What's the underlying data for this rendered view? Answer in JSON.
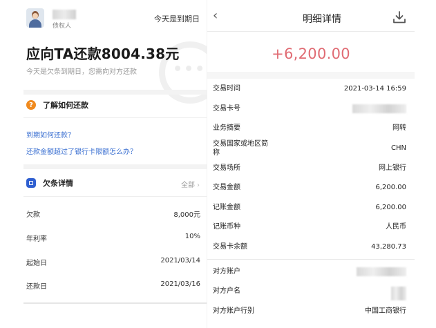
{
  "left": {
    "creditor_label": "债权人",
    "due_today": "今天是到期日",
    "amount_title": "应向TA还款8004.38元",
    "subtitle": "今天是欠条到期日，您需向对方还款",
    "learn": {
      "icon": "?",
      "title": "了解如何还款",
      "links": [
        "到期如何还款？",
        "还款金额超过了银行卡限额怎么办？"
      ]
    },
    "debt": {
      "title": "欠条详情",
      "all_label": "全部",
      "rows": [
        {
          "label": "欠款",
          "value": "8,000元"
        },
        {
          "label": "年利率",
          "value": "10%"
        },
        {
          "label": "起始日",
          "value": "2021/03/14"
        },
        {
          "label": "还款日",
          "value": "2021/03/16"
        }
      ]
    }
  },
  "right": {
    "back_icon": "‹",
    "title": "明细详情",
    "amount": "+6,200.00",
    "rows": [
      {
        "label": "交易时间",
        "value": "2021-03-14 16:59"
      },
      {
        "label": "交易卡号",
        "value": ""
      },
      {
        "label": "业务摘要",
        "value": "网转"
      },
      {
        "label": "交易国家或地区简称",
        "value": "CHN"
      },
      {
        "label": "交易场所",
        "value": "网上银行"
      },
      {
        "label": "交易金额",
        "value": "6,200.00"
      },
      {
        "label": "记账金额",
        "value": "6,200.00"
      },
      {
        "label": "记账币种",
        "value": "人民币"
      },
      {
        "label": "交易卡余额",
        "value": "43,280.73"
      },
      {
        "label": "对方账户",
        "value": ""
      },
      {
        "label": "对方户名",
        "value": ""
      },
      {
        "label": "对方账户行别",
        "value": "中国工商银行"
      }
    ],
    "colors": {
      "amount": "#e06b73",
      "link": "#3a6fd1"
    }
  }
}
